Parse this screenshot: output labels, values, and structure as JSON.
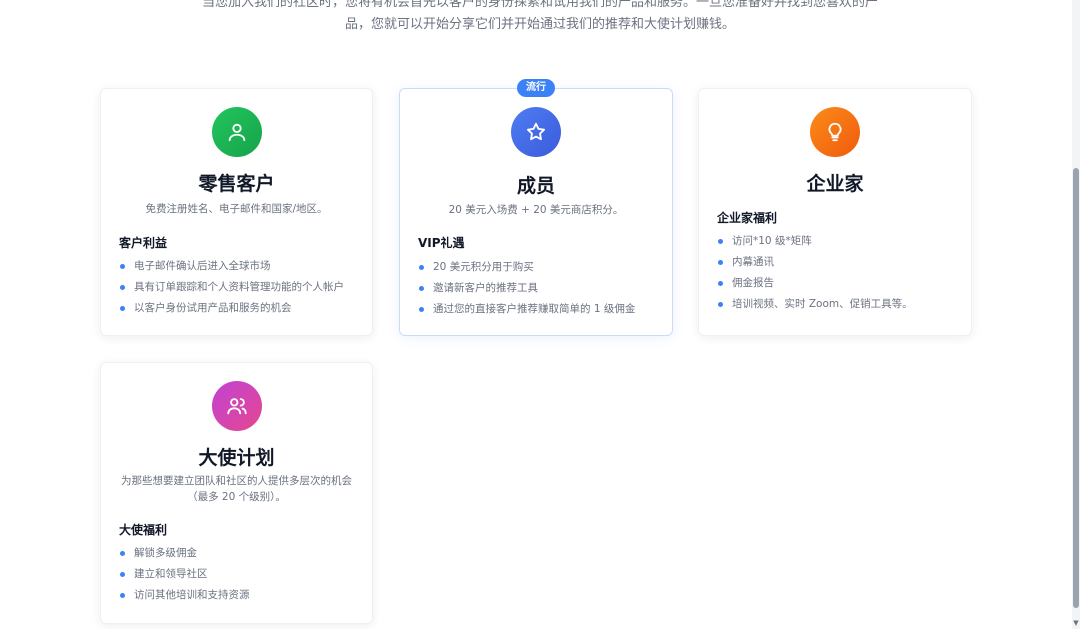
{
  "intro": {
    "line1": "当您加入我们的社区时，您将有机会首先以客户的身份探索和试用我们的产品和服务。一旦您准备好并找到您喜欢的产",
    "line2": "品，您就可以开始分享它们并开始通过我们的推荐和大使计划赚钱。"
  },
  "cards": [
    {
      "icon": "user-icon",
      "color": "#22c55e",
      "title": "零售客户",
      "desc": "免费注册姓名、电子邮件和国家/地区。",
      "section": "客户利益",
      "items": [
        "电子邮件确认后进入全球市场",
        "具有订单跟踪和个人资料管理功能的个人帐户",
        "以客户身份试用产品和服务的机会"
      ]
    },
    {
      "icon": "star-icon",
      "color": "#3b5bdb",
      "badge": "流行",
      "title": "成员",
      "desc": "20 美元入场费 + 20 美元商店积分。",
      "section": "VIP礼遇",
      "items": [
        "20 美元积分用于购买",
        "邀请新客户的推荐工具",
        "通过您的直接客户推荐赚取简单的 1 级佣金"
      ]
    },
    {
      "icon": "lightbulb-icon",
      "color": "#f05a0c",
      "title": "企业家",
      "section": "企业家福利",
      "items": [
        "访问*10 级*矩阵",
        "内幕通讯",
        "佣金报告",
        "培训视频、实时 Zoom、促销工具等。"
      ]
    },
    {
      "icon": "users-icon",
      "color": "#c044d4",
      "title": "大使计划",
      "desc": "为那些想要建立团队和社区的人提供多层次的机会（最多 20 个级别）。",
      "section": "大使福利",
      "items": [
        "解锁多级佣金",
        "建立和领导社区",
        "访问其他培训和支持资源"
      ]
    }
  ]
}
